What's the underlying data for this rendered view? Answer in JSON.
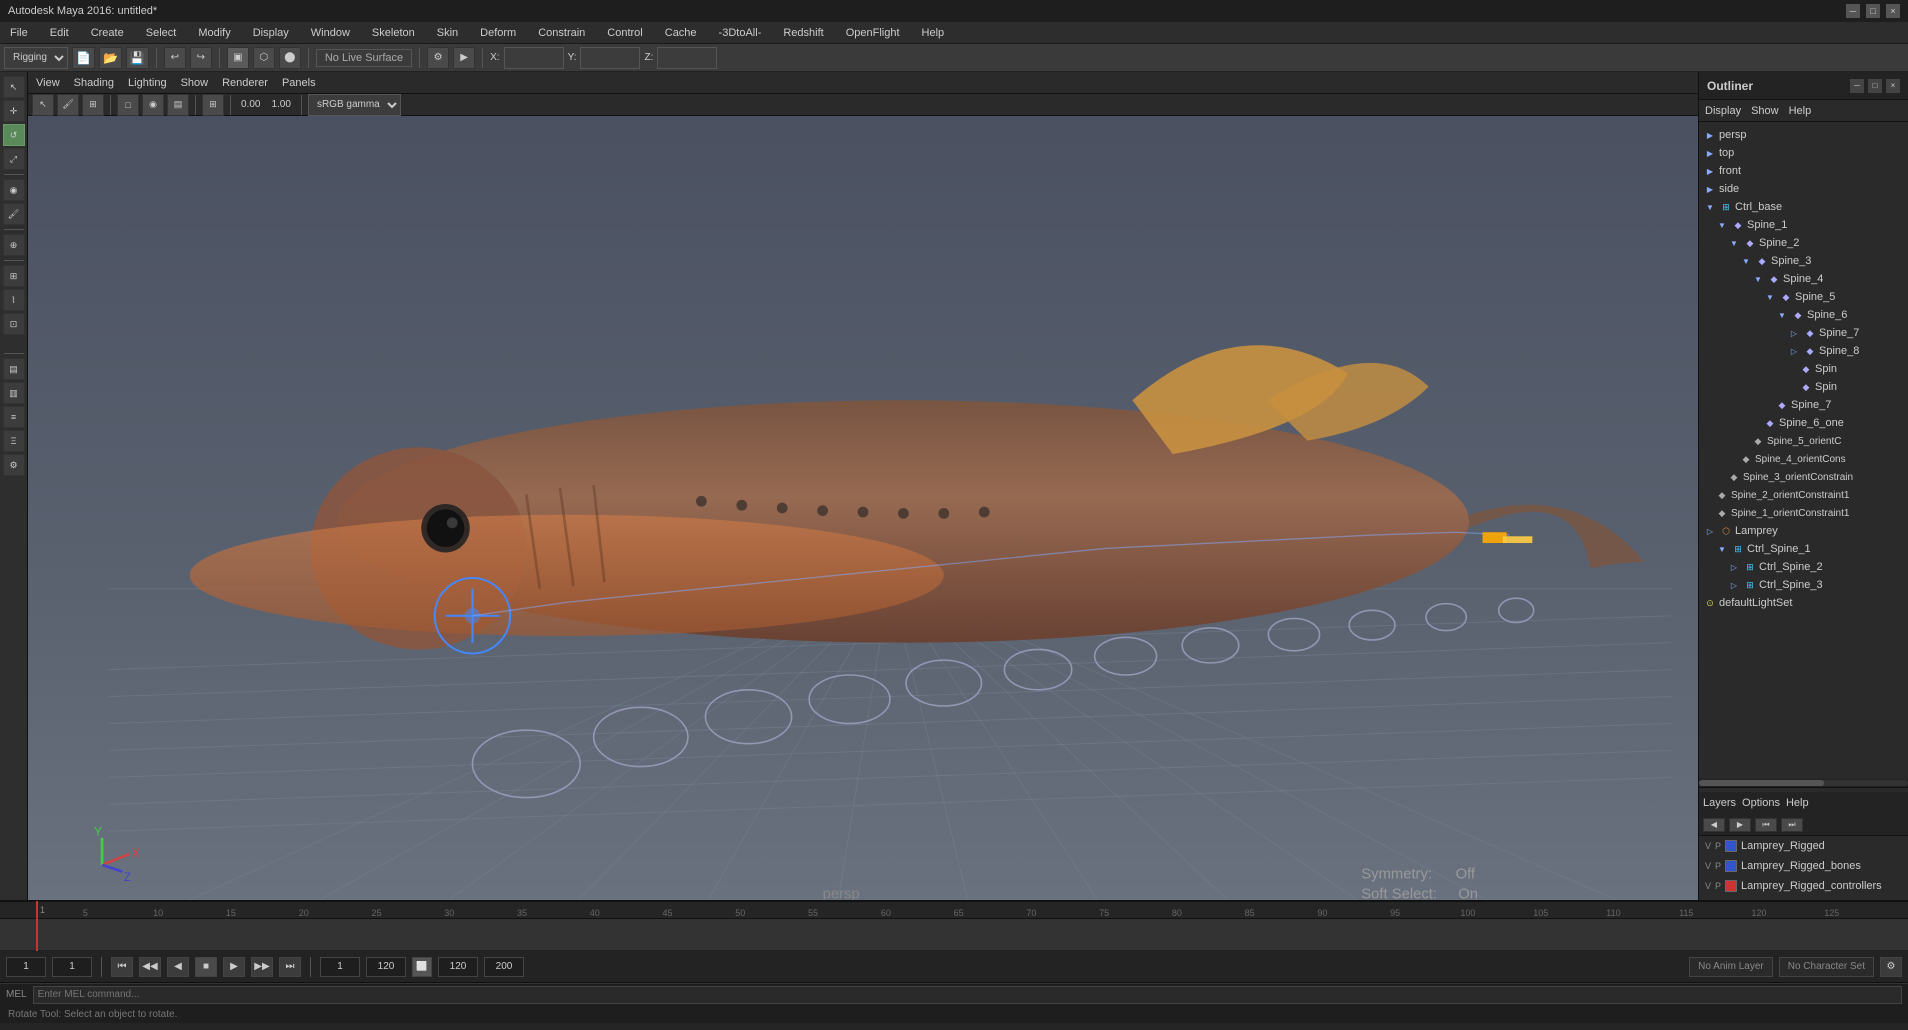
{
  "app": {
    "title": "Autodesk Maya 2016: untitled*",
    "window_controls": [
      "-",
      "□",
      "×"
    ]
  },
  "menu_bar": {
    "items": [
      "File",
      "Edit",
      "Create",
      "Select",
      "Modify",
      "Display",
      "Window",
      "Skeleton",
      "Skin",
      "Deform",
      "Constrain",
      "Control",
      "Cache",
      "-3DtoAll-",
      "Redshift",
      "OpenFlight",
      "Help"
    ]
  },
  "main_toolbar": {
    "rigging_dropdown": "Rigging",
    "no_live_surface": "No Live Surface",
    "x_label": "X:",
    "y_label": "Y:",
    "z_label": "Z:"
  },
  "viewport": {
    "menu_items": [
      "View",
      "Shading",
      "Lighting",
      "Show",
      "Renderer",
      "Panels"
    ],
    "camera": "persp",
    "symmetry_label": "Symmetry:",
    "symmetry_value": "Off",
    "soft_select_label": "Soft Select:",
    "soft_select_value": "On",
    "gamma": "sRGB gamma",
    "coord_value": "0.00",
    "zoom_value": "1.00"
  },
  "outliner": {
    "title": "Outliner",
    "menu_items": [
      "Display",
      "Show",
      "Help"
    ],
    "items": [
      {
        "label": "persp",
        "level": 0,
        "type": "camera",
        "expanded": false
      },
      {
        "label": "top",
        "level": 0,
        "type": "camera",
        "expanded": false
      },
      {
        "label": "front",
        "level": 0,
        "type": "camera",
        "expanded": false
      },
      {
        "label": "side",
        "level": 0,
        "type": "camera",
        "expanded": false
      },
      {
        "label": "Ctrl_base",
        "level": 0,
        "type": "ctrl",
        "expanded": true
      },
      {
        "label": "Spine_1",
        "level": 1,
        "type": "joint",
        "expanded": true
      },
      {
        "label": "Spine_2",
        "level": 2,
        "type": "joint",
        "expanded": true
      },
      {
        "label": "Spine_3",
        "level": 3,
        "type": "joint",
        "expanded": true
      },
      {
        "label": "Spine_4",
        "level": 4,
        "type": "joint",
        "expanded": true
      },
      {
        "label": "Spine_5",
        "level": 5,
        "type": "joint",
        "expanded": true
      },
      {
        "label": "Spine_6",
        "level": 6,
        "type": "joint",
        "expanded": true
      },
      {
        "label": "Spine_7",
        "level": 7,
        "type": "joint",
        "expanded": false
      },
      {
        "label": "Spine_8",
        "level": 7,
        "type": "joint",
        "expanded": false
      },
      {
        "label": "Spin",
        "level": 8,
        "type": "joint",
        "expanded": false
      },
      {
        "label": "Spin",
        "level": 8,
        "type": "joint",
        "expanded": false
      },
      {
        "label": "Spine_7",
        "level": 6,
        "type": "joint",
        "expanded": false
      },
      {
        "label": "Spine_6_one",
        "level": 5,
        "type": "joint",
        "expanded": false
      },
      {
        "label": "Spine_5_orientC",
        "level": 4,
        "type": "joint",
        "expanded": false
      },
      {
        "label": "Spine_4_orientCons",
        "level": 3,
        "type": "joint",
        "expanded": false
      },
      {
        "label": "Spine_3_orientConstrain",
        "level": 2,
        "type": "joint",
        "expanded": false
      },
      {
        "label": "Spine_2_orientConstraint1",
        "level": 1,
        "type": "joint",
        "expanded": false
      },
      {
        "label": "Spine_1_orientConstraint1",
        "level": 1,
        "type": "joint",
        "expanded": false
      },
      {
        "label": "Lamprey",
        "level": 0,
        "type": "mesh",
        "expanded": false
      },
      {
        "label": "Ctrl_Spine_1",
        "level": 1,
        "type": "ctrl",
        "expanded": false
      },
      {
        "label": "Ctrl_Spine_2",
        "level": 2,
        "type": "ctrl",
        "expanded": false
      },
      {
        "label": "Ctrl_Spine_3",
        "level": 2,
        "type": "ctrl",
        "expanded": false
      },
      {
        "label": "defaultLightSet",
        "level": 0,
        "type": "set",
        "expanded": false
      }
    ]
  },
  "layers": {
    "toolbar_items": [
      "Layers",
      "Options",
      "Help"
    ],
    "items": [
      {
        "label": "Lamprey_Rigged",
        "color": "#3355cc",
        "v": "V",
        "p": "P"
      },
      {
        "label": "Lamprey_Rigged_bones",
        "color": "#3355cc",
        "v": "V",
        "p": "P"
      },
      {
        "label": "Lamprey_Rigged_controllers",
        "color": "#cc3333",
        "v": "V",
        "p": "P"
      }
    ]
  },
  "timeline": {
    "start": 1,
    "end": 120,
    "current": 1,
    "range_start": 1,
    "range_end": 120,
    "playback_start": 1,
    "playback_end": 200,
    "ticks": [
      "1",
      "",
      "",
      "",
      "5",
      "",
      "",
      "",
      "",
      "10",
      "",
      "",
      "",
      "",
      "15",
      "",
      "",
      "",
      "",
      "20",
      "",
      "",
      "",
      "",
      "25",
      "",
      "",
      "",
      "",
      "30",
      "",
      "",
      "",
      "",
      "35",
      "",
      "",
      "",
      "",
      "40",
      "",
      "",
      "",
      "",
      "45",
      "",
      "",
      "",
      "",
      "50",
      "",
      "",
      "",
      "",
      "55",
      "",
      "",
      "",
      "",
      "60",
      "",
      "",
      "",
      "",
      "65",
      "",
      "",
      "",
      "",
      "70",
      "",
      "",
      "",
      "",
      "75",
      "",
      "",
      "",
      "",
      "80",
      "",
      "",
      "",
      "",
      "85",
      "",
      "",
      "",
      "",
      "90",
      "",
      "",
      "",
      "",
      "95",
      "",
      "",
      "",
      "",
      "100",
      "",
      "",
      "",
      "",
      "105",
      "",
      "",
      "",
      "",
      "110",
      "",
      "",
      "",
      "",
      "115",
      "",
      "",
      "",
      "",
      "120",
      "",
      "",
      "",
      "",
      "125"
    ]
  },
  "status": {
    "mel_label": "MEL",
    "bottom_text": "Rotate Tool: Select an object to rotate.",
    "no_anim_layer": "No Anim Layer",
    "no_char_set": "No Character Set"
  },
  "playback": {
    "current_frame": "1",
    "current_frame2": "1",
    "range_start": "1",
    "range_end": "120",
    "playback_end": "200"
  }
}
